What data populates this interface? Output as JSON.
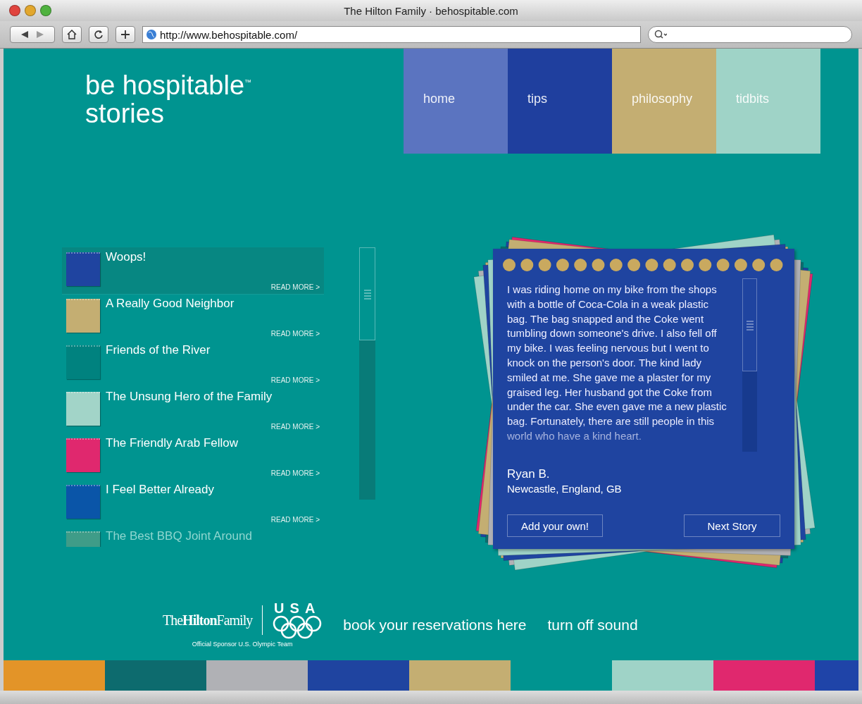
{
  "window": {
    "title": "The Hilton Family · behospitable.com"
  },
  "toolbar": {
    "address": "http://www.behospitable.com/"
  },
  "site": {
    "title": "be hospitable",
    "trademark": "™",
    "subtitle": "stories"
  },
  "nav": [
    {
      "label": "home",
      "color": "#5b74c0",
      "selected": false
    },
    {
      "label": "tips",
      "color": "#1f3f9e",
      "selected": false
    },
    {
      "label": "philosophy",
      "color": "#c4ae72",
      "selected": false
    },
    {
      "label": "tidbits",
      "color": "#9fd3c7",
      "selected": false
    }
  ],
  "stories": [
    {
      "title": "Woops!",
      "link": "READ MORE >",
      "color": "#1f44a0",
      "selected": true
    },
    {
      "title": "A Really Good Neighbor",
      "link": "READ MORE >",
      "color": "#c4ae72",
      "selected": false
    },
    {
      "title": "Friends of the River",
      "link": "READ MORE >",
      "color": "#00827f",
      "selected": false
    },
    {
      "title": "The Unsung Hero of the Family",
      "link": "READ MORE >",
      "color": "#a2d4c8",
      "selected": false
    },
    {
      "title": "The Friendly Arab Fellow",
      "link": "READ MORE >",
      "color": "#e0286e",
      "selected": false
    },
    {
      "title": "I Feel Better Already",
      "link": "READ MORE >",
      "color": "#0a55a8",
      "selected": false
    },
    {
      "title": "The Best BBQ Joint Around",
      "color": "#3f9c88",
      "selected": false,
      "faded": true
    }
  ],
  "story": {
    "text": "I was riding home on my bike from the shops with a bottle of Coca-Cola in a weak plastic bag. The bag snapped and the Coke went tumbling down someone's drive. I also fell off my bike. I was feeling nervous but I went to knock on the person's door. The kind lady smiled at me. She gave me a plaster for my graised leg. Her husband got the Coke from under the car. She even gave me a new plastic bag. Fortunately, there are still people in this world who have a kind heart.",
    "author": "Ryan B.",
    "location": "Newcastle, England, GB",
    "buttons": [
      "Add your own!",
      "Next Story"
    ]
  },
  "footer": {
    "brand_the": "The",
    "brand_hilton": "Hilton",
    "brand_family": "Family",
    "olympic": "USA",
    "sponsor": "Official Sponsor U.S. Olympic Team",
    "links": [
      "book your reservations here",
      "turn off sound"
    ]
  },
  "color_bar": {
    "left": [
      {
        "color": "#e39428"
      },
      {
        "color": "#0d6b6e"
      },
      {
        "color": "#b0b1b5"
      },
      {
        "color": "#1f44a0"
      },
      {
        "color": "#c4ae72"
      }
    ],
    "right": [
      {
        "color": "#9fd3c7"
      },
      {
        "color": "#e0286e"
      },
      {
        "color": "#1f44a8"
      }
    ]
  }
}
